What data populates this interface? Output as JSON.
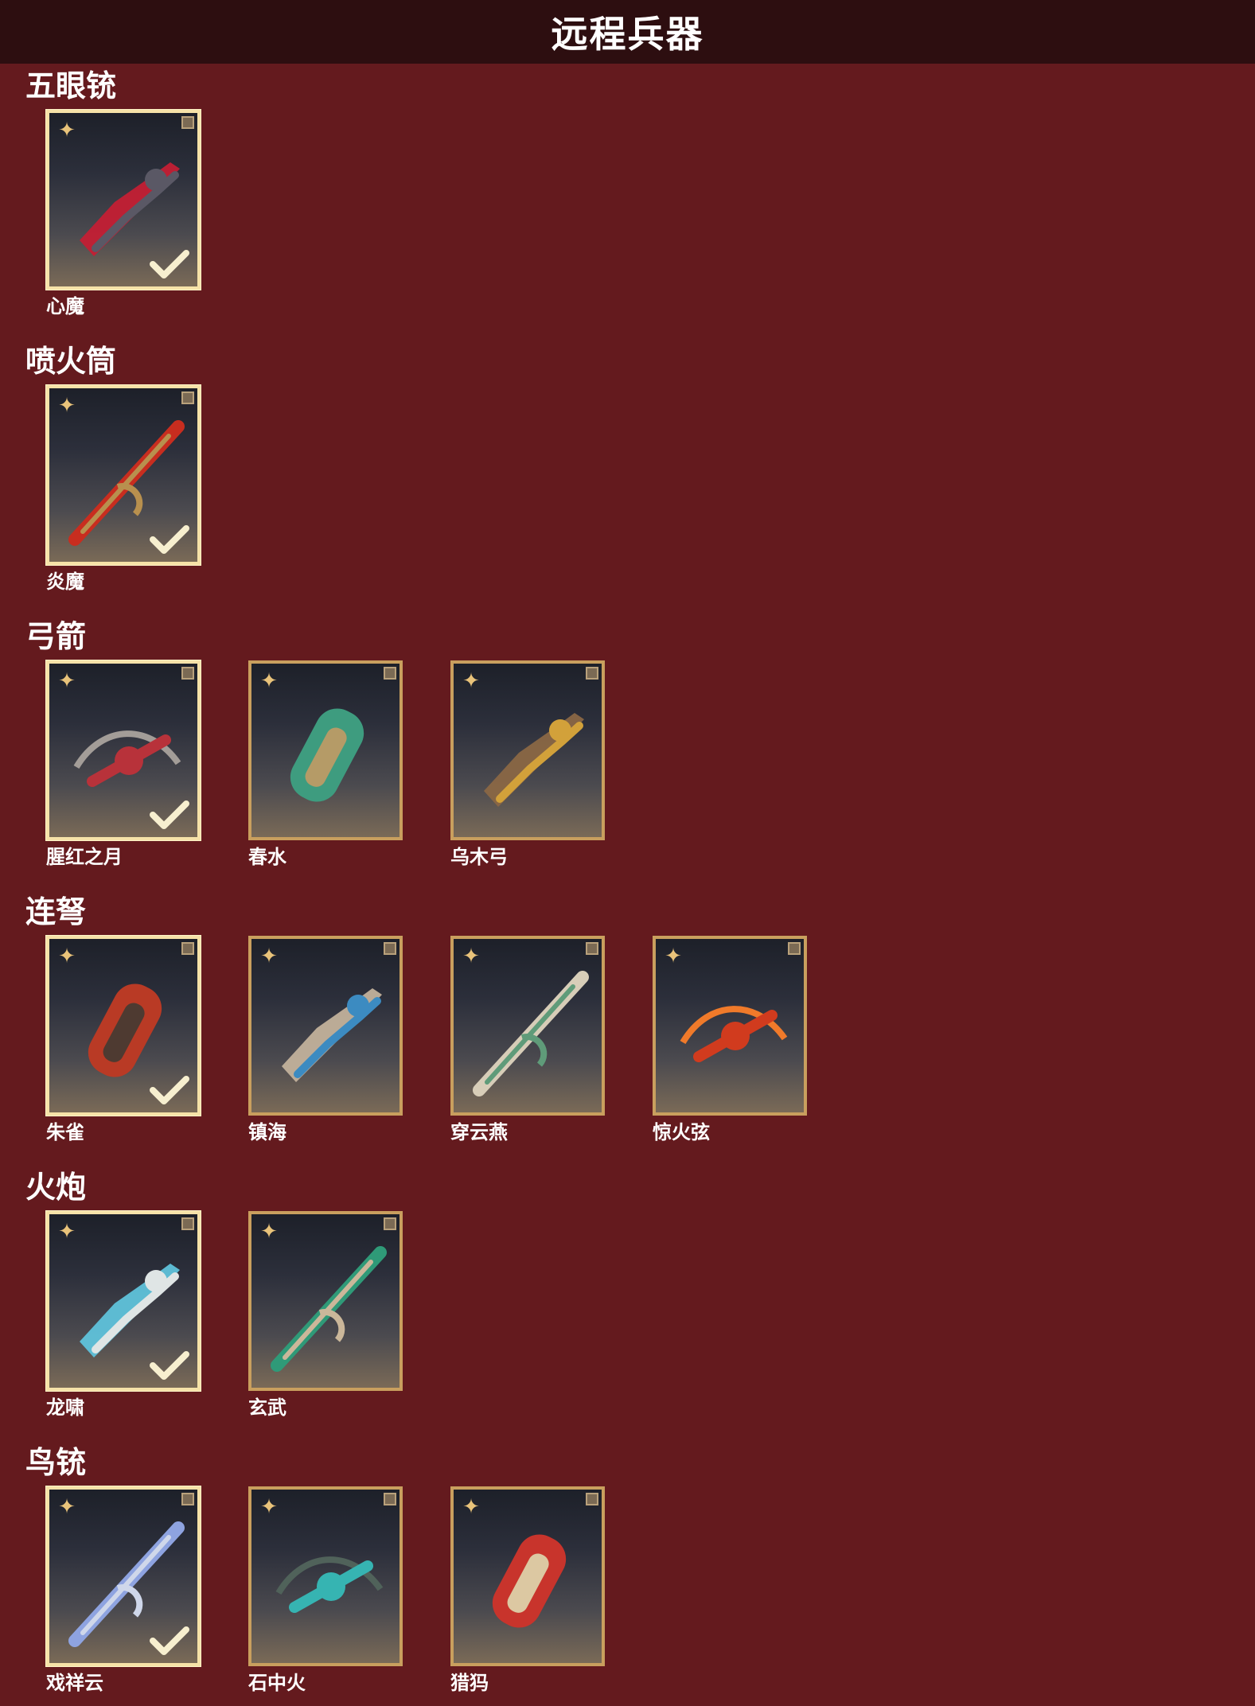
{
  "title": "远程兵器",
  "sections": [
    {
      "title": "五眼铳",
      "items": [
        {
          "name": "心魔",
          "selected": true,
          "accent": "#c31f34",
          "secondary": "#5a5865"
        }
      ]
    },
    {
      "title": "喷火筒",
      "items": [
        {
          "name": "炎魔",
          "selected": true,
          "accent": "#c82d1f",
          "secondary": "#b8904e"
        }
      ]
    },
    {
      "title": "弓箭",
      "items": [
        {
          "name": "腥红之月",
          "selected": true,
          "accent": "#b8323a",
          "secondary": "#a39d98"
        },
        {
          "name": "春水",
          "selected": false,
          "accent": "#3e9c7f",
          "secondary": "#b59b67"
        },
        {
          "name": "乌木弓",
          "selected": false,
          "accent": "#8a6744",
          "secondary": "#d2a13a"
        }
      ]
    },
    {
      "title": "连弩",
      "items": [
        {
          "name": "朱雀",
          "selected": true,
          "accent": "#b93a25",
          "secondary": "#4e3a31"
        },
        {
          "name": "镇海",
          "selected": false,
          "accent": "#c2b19b",
          "secondary": "#3c8bc1"
        },
        {
          "name": "穿云燕",
          "selected": false,
          "accent": "#d7cdb8",
          "secondary": "#5f9b79"
        },
        {
          "name": "惊火弦",
          "selected": false,
          "accent": "#d13b1e",
          "secondary": "#f07a2a"
        }
      ]
    },
    {
      "title": "火炮",
      "items": [
        {
          "name": "龙啸",
          "selected": true,
          "accent": "#5fc2da",
          "secondary": "#dfe5e5"
        },
        {
          "name": "玄武",
          "selected": false,
          "accent": "#2f9a78",
          "secondary": "#cbb79a"
        }
      ]
    },
    {
      "title": "鸟铳",
      "items": [
        {
          "name": "戏祥云",
          "selected": true,
          "accent": "#8ea3e0",
          "secondary": "#cfd7ea"
        },
        {
          "name": "石中火",
          "selected": false,
          "accent": "#36b4b2",
          "secondary": "#50625a"
        },
        {
          "name": "猎犸",
          "selected": false,
          "accent": "#c8342c",
          "secondary": "#dcc8a2"
        }
      ]
    }
  ],
  "icons": {
    "rarity": "star-badge-icon",
    "corner": "corner-tag-icon",
    "equipped": "checkmark-icon"
  },
  "colors": {
    "background": "#641a1e",
    "header": "#2d0e10",
    "frame": "#c99f5e",
    "frame_selected": "#f6e2a8"
  }
}
